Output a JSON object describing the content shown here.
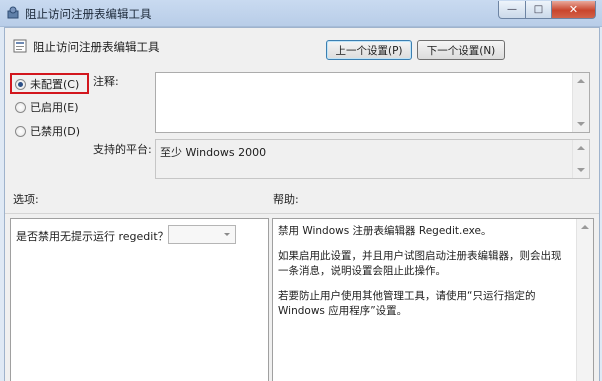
{
  "window": {
    "title": "阻止访问注册表编辑工具",
    "minimize_label": "—",
    "maximize_label": "□",
    "close_label": "✕"
  },
  "header": {
    "policy_title": "阻止访问注册表编辑工具",
    "prev_button": "上一个设置(P)",
    "next_button": "下一个设置(N)"
  },
  "state": {
    "options": [
      {
        "label": "未配置(C)",
        "checked": true
      },
      {
        "label": "已启用(E)",
        "checked": false
      },
      {
        "label": "已禁用(D)",
        "checked": false
      }
    ]
  },
  "comment": {
    "label": "注释:",
    "value": ""
  },
  "platform": {
    "label": "支持的平台:",
    "value": "至少 Windows 2000"
  },
  "options_panel": {
    "label": "选项:",
    "question": "是否禁用无提示运行 regedit？",
    "combo_value": ""
  },
  "help_panel": {
    "label": "帮助:",
    "paragraphs": [
      "禁用 Windows 注册表编辑器 Regedit.exe。",
      "如果启用此设置，并且用户试图启动注册表编辑器，则会出现一条消息，说明设置会阻止此操作。",
      "若要防止用户使用其他管理工具，请使用“只运行指定的 Windows 应用程序”设置。"
    ]
  },
  "colors": {
    "highlight_border": "#d2161d",
    "title_bar": "#c9daf0",
    "close_button": "#c9452d"
  }
}
